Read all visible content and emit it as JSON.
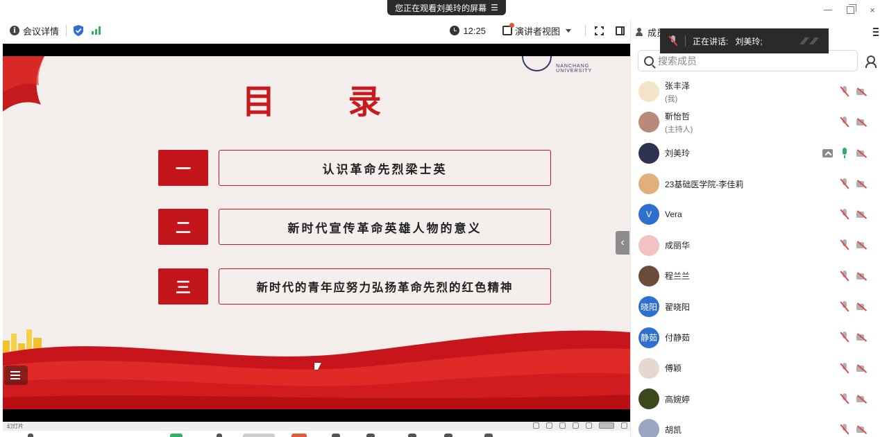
{
  "banner": {
    "text": "您正在观看刘美玲的屏幕"
  },
  "toolbar": {
    "meeting_info_label": "会议详情",
    "time": "12:25",
    "presenter_view_label": "演讲者视图"
  },
  "slide": {
    "title": "目 录",
    "items": [
      {
        "num": "一",
        "text": "认识革命先烈梁士英"
      },
      {
        "num": "二",
        "text": "新时代宣传革命英雄人物的意义"
      },
      {
        "num": "三",
        "text": "新时代的青年应努力弘扬革命先烈的红色精神"
      }
    ],
    "logo_text": "NANCHANG UNIVERSITY"
  },
  "statusbar": {
    "slide_label": "幻灯片"
  },
  "panel": {
    "header_label": "成员",
    "speaking_label": "正在讲话:",
    "speaking_name": "刘美玲;",
    "search_placeholder": "搜索成员",
    "members": [
      {
        "name": "张丰泽",
        "role": "(我)",
        "avatar_color": "#f3e3c8",
        "avatar_text": "",
        "sharing": false,
        "mic": "off"
      },
      {
        "name": "靳怡哲",
        "role": "(主持人)",
        "avatar_color": "#b9897a",
        "avatar_text": "",
        "sharing": false,
        "mic": "off"
      },
      {
        "name": "刘美玲",
        "role": "",
        "avatar_color": "#2e3350",
        "avatar_text": "",
        "sharing": true,
        "mic": "on"
      },
      {
        "name": "23基础医学院-李佳莉",
        "role": "",
        "avatar_color": "#e0b07a",
        "avatar_text": "",
        "sharing": false,
        "mic": "off"
      },
      {
        "name": "Vera",
        "role": "",
        "avatar_color": "#2f6fd0",
        "avatar_text": "V",
        "sharing": false,
        "mic": "off"
      },
      {
        "name": "成丽华",
        "role": "",
        "avatar_color": "#f2c1c1",
        "avatar_text": "",
        "sharing": false,
        "mic": "off"
      },
      {
        "name": "程兰兰",
        "role": "",
        "avatar_color": "#6b4b3a",
        "avatar_text": "",
        "sharing": false,
        "mic": "off"
      },
      {
        "name": "翟晓阳",
        "role": "",
        "avatar_color": "#2f6fd0",
        "avatar_text": "晓阳",
        "sharing": false,
        "mic": "off"
      },
      {
        "name": "付静茹",
        "role": "",
        "avatar_color": "#2f6fd0",
        "avatar_text": "静茹",
        "sharing": false,
        "mic": "off"
      },
      {
        "name": "傅颖",
        "role": "",
        "avatar_color": "#e8d6d0",
        "avatar_text": "",
        "sharing": false,
        "mic": "off"
      },
      {
        "name": "高婉婷",
        "role": "",
        "avatar_color": "#3a4a1e",
        "avatar_text": "",
        "sharing": false,
        "mic": "off"
      },
      {
        "name": "胡凯",
        "role": "",
        "avatar_color": "#9aa6c2",
        "avatar_text": "",
        "sharing": false,
        "mic": "off"
      }
    ]
  },
  "colors": {
    "accent_red": "#c3151c",
    "brand_blue": "#2f6fd0",
    "mic_on": "#2fb06a"
  }
}
